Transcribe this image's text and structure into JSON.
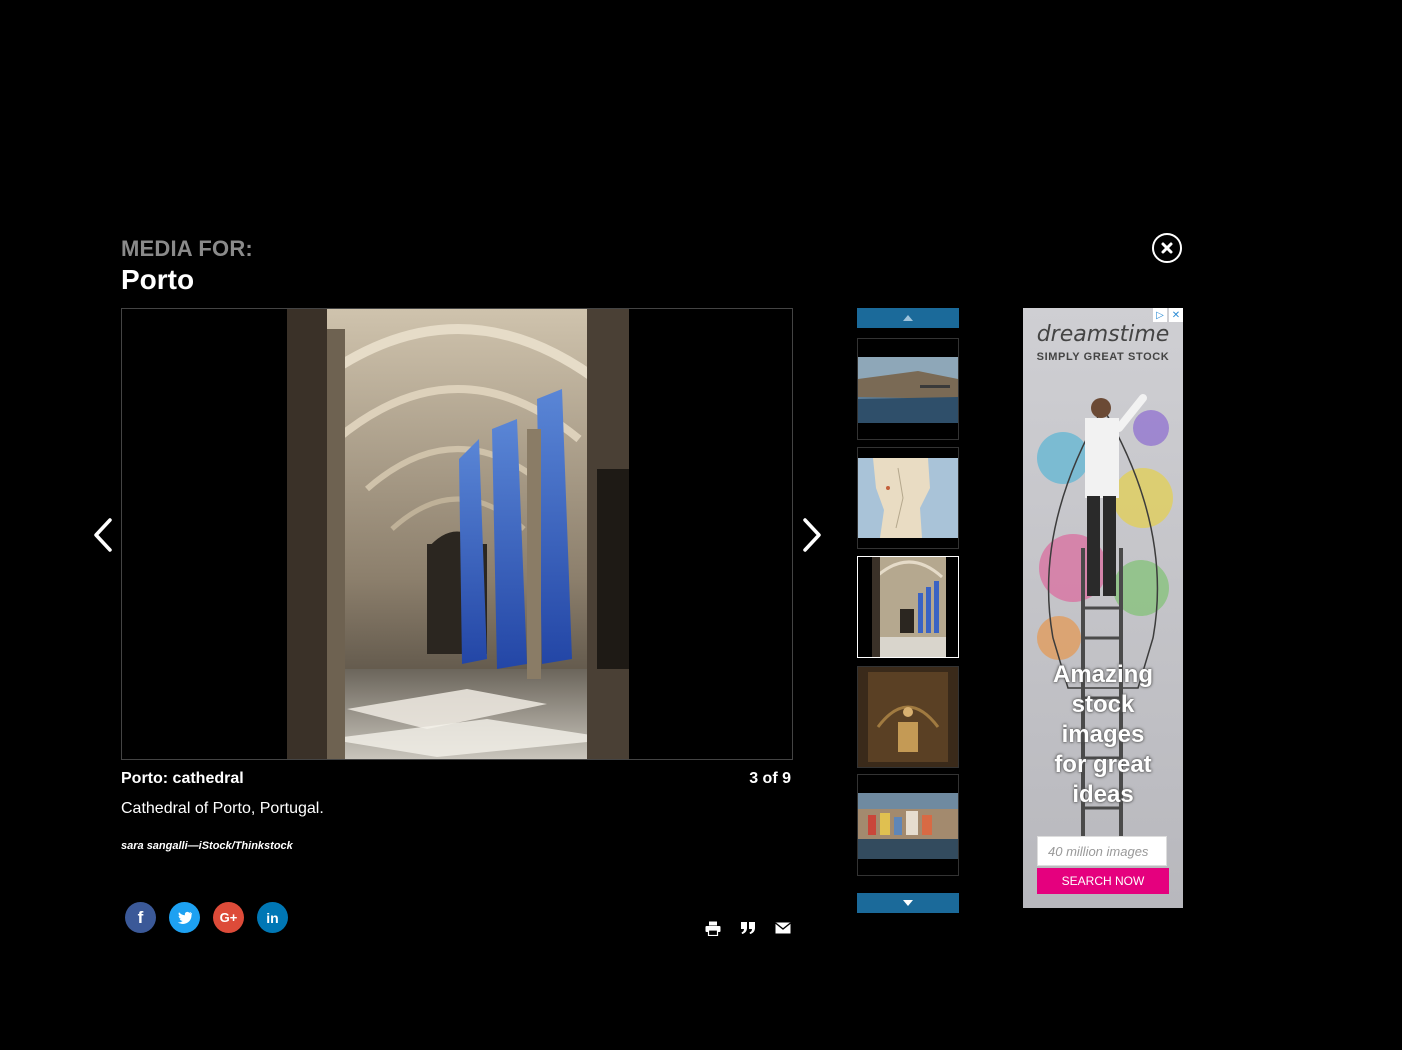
{
  "header": {
    "label": "MEDIA FOR:",
    "title": "Porto"
  },
  "caption": {
    "title": "Porto: cathedral",
    "counter": "3 of 9",
    "description": "Cathedral of Porto, Portugal.",
    "credit": "sara sangalli—iStock/Thinkstock"
  },
  "ad": {
    "brand": "dreamstime",
    "tagline": "SIMPLY GREAT STOCK",
    "headline": [
      "Amazing",
      "stock",
      "images",
      "for great",
      "ideas"
    ],
    "input_placeholder": "40 million images",
    "button_label": "SEARCH NOW"
  },
  "colors": {
    "background": "#000000",
    "strip_button": "#1b6a9a",
    "facebook": "#3b5998",
    "twitter": "#1da1f2",
    "google_plus": "#dd4b39",
    "linkedin": "#0077b5",
    "ad_button": "#e5007e"
  },
  "icons": {
    "close": "close-circle-icon",
    "prev": "chevron-left-icon",
    "next": "chevron-right-icon",
    "zoom": "zoom-in-icon",
    "print": "print-icon",
    "cite": "quote-icon",
    "email": "email-icon"
  }
}
